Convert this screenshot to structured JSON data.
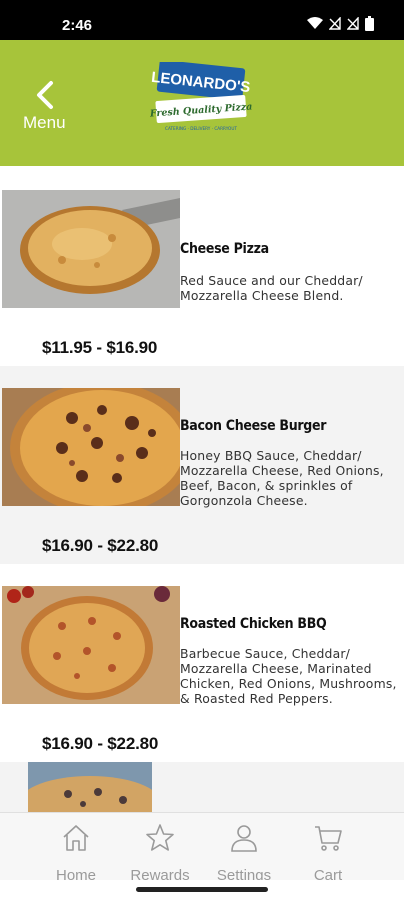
{
  "status_bar": {
    "time": "2:46"
  },
  "header": {
    "back_label": "Menu",
    "logo": {
      "brand": "LEONARDO'S",
      "tagline": "Fresh Quality Pizza",
      "small": "CATERING · DELIVERY · CARRYOUT"
    }
  },
  "menu_items": [
    {
      "name": "Cheese Pizza",
      "description": "Red Sauce and our Cheddar/ Mozzarella Cheese Blend.",
      "price": "$11.95 - $16.90"
    },
    {
      "name": "Bacon Cheese Burger",
      "description": "Honey BBQ Sauce, Cheddar/ Mozzarella Cheese, Red Onions, Beef, Bacon, & sprinkles of Gorgonzola Cheese.",
      "price": "$16.90 - $22.80"
    },
    {
      "name": "Roasted Chicken BBQ",
      "description": "Barbecue Sauce, Cheddar/ Mozzarella Cheese, Marinated Chicken, Red Onions, Mushrooms, & Roasted Red Peppers.",
      "price": "$16.90 - $22.80"
    }
  ],
  "bottom_nav": [
    {
      "label": "Home",
      "icon": "home-icon"
    },
    {
      "label": "Rewards",
      "icon": "star-icon"
    },
    {
      "label": "Settings",
      "icon": "person-icon"
    },
    {
      "label": "Cart",
      "icon": "cart-icon"
    }
  ],
  "colors": {
    "header": "#a7c43a",
    "logo_blue": "#1f5fa8",
    "nav_text": "#9a9a9a"
  }
}
